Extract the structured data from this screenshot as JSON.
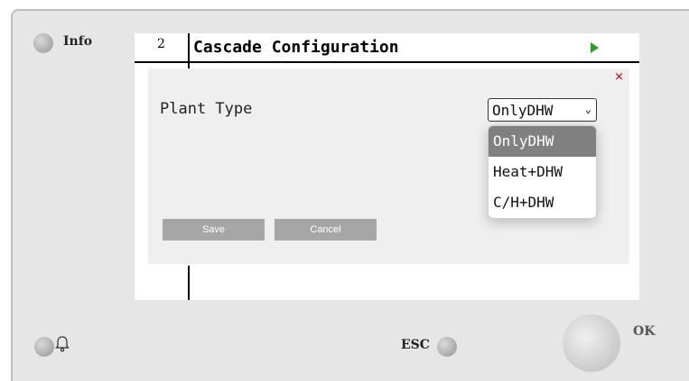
{
  "hardware": {
    "info_label": "Info",
    "esc_label": "ESC",
    "ok_label": "OK"
  },
  "screen": {
    "page_number": "2",
    "title": "Cascade Configuration",
    "play_icon_color": "#2ca02c"
  },
  "dialog": {
    "close_symbol": "×",
    "field_label": "Plant Type",
    "select_value": "OnlyDHW",
    "options": [
      "OnlyDHW",
      "Heat+DHW",
      "C/H+DHW"
    ],
    "selected_index": 0,
    "save_label": "Save",
    "cancel_label": "Cancel"
  },
  "colors": {
    "accent_play": "#2ca02c",
    "close_red": "#cc0000",
    "button_grey": "#a6a6a6",
    "option_selected": "#808080"
  }
}
